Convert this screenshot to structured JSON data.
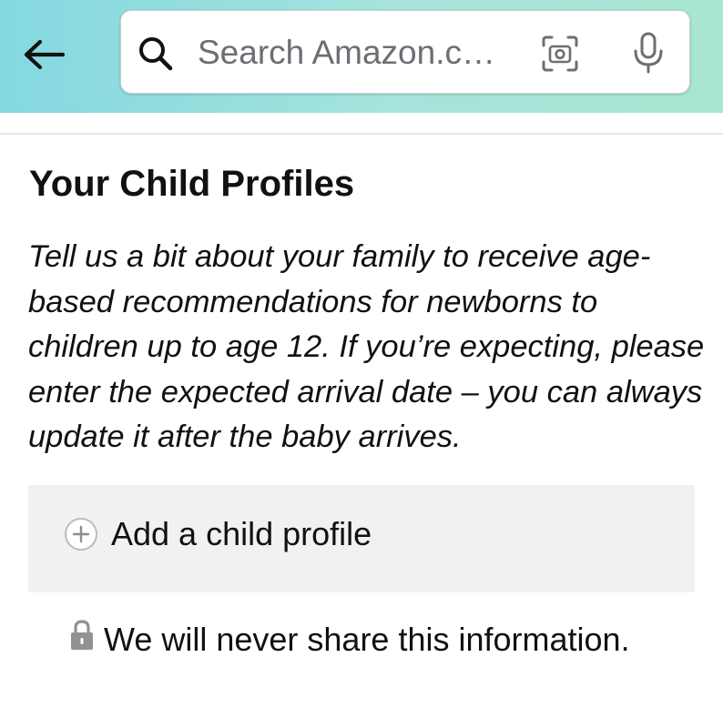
{
  "header": {
    "back_icon": "arrow-left-icon",
    "search": {
      "placeholder": "Search Amazon.c…",
      "search_icon": "search-icon",
      "camera_icon": "camera-scan-icon",
      "mic_icon": "microphone-icon"
    },
    "colors": {
      "gradient_start": "#84d8e1",
      "gradient_end": "#a8e6d2"
    }
  },
  "main": {
    "title": "Your Child Profiles",
    "description": "Tell us a bit about your family to receive age-based recommendations for newborns to children up to age 12. If you’re expecting, please enter the expected arrival date – you can always update it after the baby arrives.",
    "add_child": {
      "label": "Add a child profile",
      "icon": "plus-circle-icon"
    },
    "privacy": {
      "text": "We will never share this information.",
      "icon": "lock-icon"
    }
  }
}
